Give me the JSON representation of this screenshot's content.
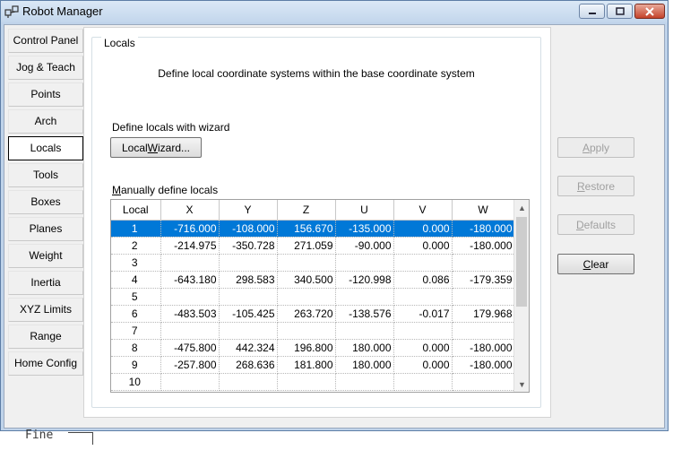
{
  "window": {
    "title": "Robot Manager"
  },
  "sidebar": {
    "items": [
      {
        "label": "Control Panel"
      },
      {
        "label": "Jog & Teach"
      },
      {
        "label": "Points"
      },
      {
        "label": "Arch"
      },
      {
        "label": "Locals",
        "active": true
      },
      {
        "label": "Tools"
      },
      {
        "label": "Boxes"
      },
      {
        "label": "Planes"
      },
      {
        "label": "Weight"
      },
      {
        "label": "Inertia"
      },
      {
        "label": "XYZ Limits"
      },
      {
        "label": "Range"
      },
      {
        "label": "Home Config"
      }
    ]
  },
  "locals": {
    "group_title": "Locals",
    "description": "Define local coordinate systems within the base coordinate system",
    "wizard_label": "Define locals with wizard",
    "wizard_button": "Local Wizard...",
    "manual_label": "Manually define locals",
    "columns": [
      "Local",
      "X",
      "Y",
      "Z",
      "U",
      "V",
      "W"
    ],
    "rows": [
      [
        "1",
        "-716.000",
        "-108.000",
        "156.670",
        "-135.000",
        "0.000",
        "-180.000"
      ],
      [
        "2",
        "-214.975",
        "-350.728",
        "271.059",
        "-90.000",
        "0.000",
        "-180.000"
      ],
      [
        "3",
        "",
        "",
        "",
        "",
        "",
        ""
      ],
      [
        "4",
        "-643.180",
        "298.583",
        "340.500",
        "-120.998",
        "0.086",
        "-179.359"
      ],
      [
        "5",
        "",
        "",
        "",
        "",
        "",
        ""
      ],
      [
        "6",
        "-483.503",
        "-105.425",
        "263.720",
        "-138.576",
        "-0.017",
        "179.968"
      ],
      [
        "7",
        "",
        "",
        "",
        "",
        "",
        ""
      ],
      [
        "8",
        "-475.800",
        "442.324",
        "196.800",
        "180.000",
        "0.000",
        "-180.000"
      ],
      [
        "9",
        "-257.800",
        "268.636",
        "181.800",
        "180.000",
        "0.000",
        "-180.000"
      ],
      [
        "10",
        "",
        "",
        "",
        "",
        "",
        ""
      ]
    ],
    "selected_row": 0
  },
  "actions": {
    "apply": "Apply",
    "restore": "Restore",
    "defaults": "Defaults",
    "clear": "Clear"
  },
  "background": {
    "text": "Fine"
  },
  "colors": {
    "selection": "#0078d7",
    "titlebar": "#c3d6ec",
    "close": "#c4432b"
  }
}
